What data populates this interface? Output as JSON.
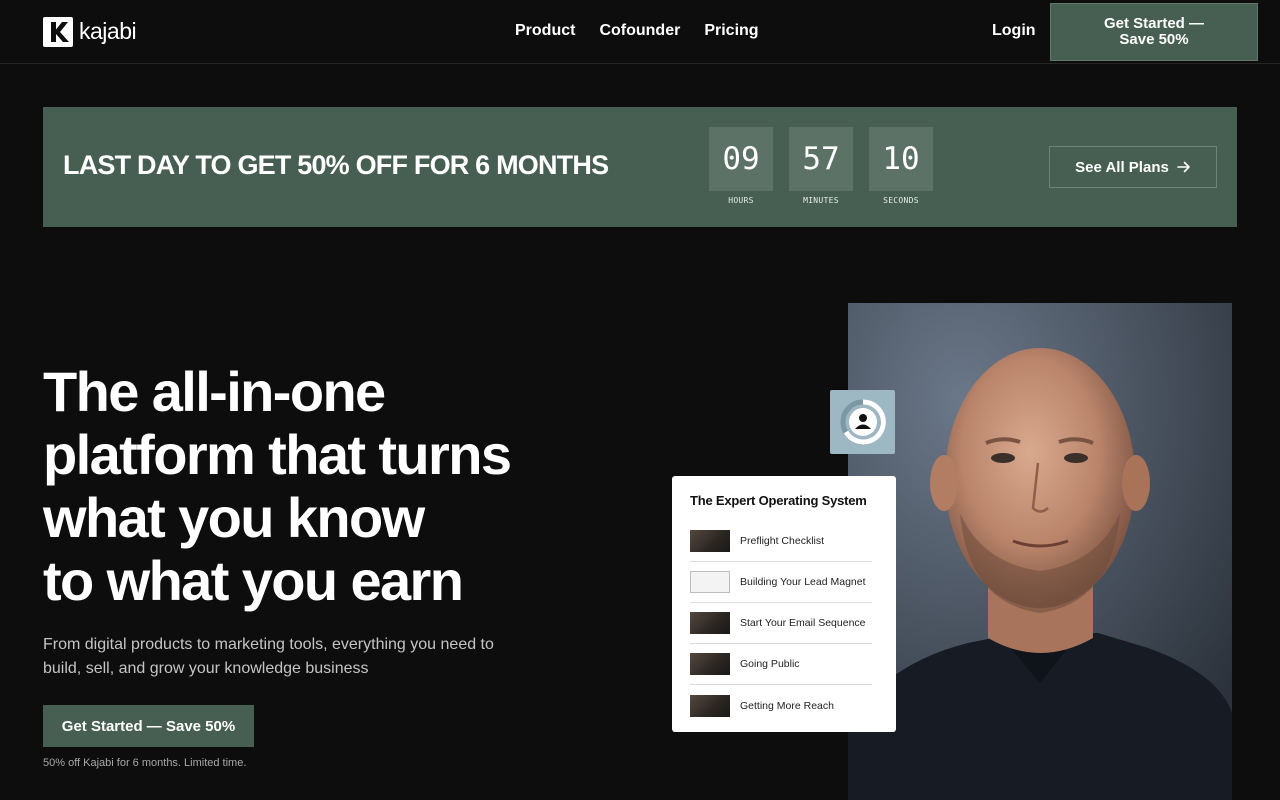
{
  "nav": {
    "logo_text": "kajabi",
    "links": [
      "Product",
      "Cofounder",
      "Pricing"
    ],
    "login": "Login",
    "cta_line1": "Get Started —",
    "cta_line2": "Save 50%"
  },
  "banner": {
    "headline": "LAST DAY TO GET 50% OFF FOR 6 MONTHS",
    "countdown": [
      {
        "value": "09",
        "label": "HOURS"
      },
      {
        "value": "57",
        "label": "MINUTES"
      },
      {
        "value": "10",
        "label": "SECONDS"
      }
    ],
    "plans_button": "See All Plans"
  },
  "hero": {
    "title_lines": [
      "The all-in-one",
      "platform that turns",
      "what you know",
      "to what you earn"
    ],
    "subtitle": "From digital products to marketing tools, everything you need to build, sell, and grow your knowledge business",
    "cta": "Get Started — Save 50%",
    "note": "50% off Kajabi for 6 months. Limited time."
  },
  "card": {
    "title": "The Expert Operating System",
    "lessons": [
      "Preflight Checklist",
      "Building Your Lead Magnet",
      "Start Your Email Sequence",
      "Going Public",
      "Getting More Reach"
    ]
  },
  "colors": {
    "brand_green": "#475f52",
    "background": "#0d0d0d",
    "badge_blue": "#9db7c3"
  },
  "icons": [
    "kajabi-logo-icon",
    "arrow-right-icon",
    "user-progress-icon"
  ]
}
